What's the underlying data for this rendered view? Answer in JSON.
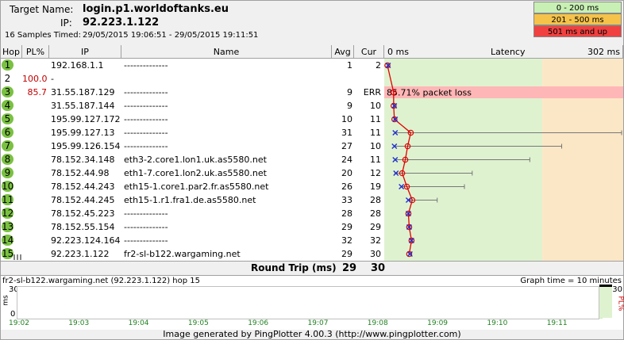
{
  "header": {
    "target_label": "Target Name:",
    "target_value": "login.p1.worldoftanks.eu",
    "ip_label": "IP:",
    "ip_value": "92.223.1.122",
    "samples_label": "16 Samples Timed:",
    "samples_value": "29/05/2015 19:06:51 - 29/05/2015 19:11:51"
  },
  "legend": [
    {
      "label": "0 - 200 ms",
      "color": "#c8f0b4"
    },
    {
      "label": "201 - 500 ms",
      "color": "#f5c24a"
    },
    {
      "label": "501 ms and up",
      "color": "#f04040"
    }
  ],
  "columns": {
    "hop": "Hop",
    "pl": "PL%",
    "ip": "IP",
    "name": "Name",
    "avg": "Avg",
    "cur": "Cur",
    "scale_min": "0 ms",
    "latency": "Latency",
    "scale_max": "302 ms"
  },
  "graph_scale_max": 302,
  "hops": [
    {
      "hop": "1",
      "pl": "",
      "ip": "192.168.1.1",
      "name": "--------------",
      "avg": "1",
      "cur": "2",
      "min": 1,
      "max": 2
    },
    {
      "hop": "2",
      "pl": "100.0",
      "ip": "-",
      "name": "",
      "avg": "",
      "cur": "",
      "min": null,
      "max": null
    },
    {
      "hop": "3",
      "pl": "85.7",
      "ip": "31.55.187.129",
      "name": "--------------",
      "avg": "9",
      "cur": "ERR",
      "min": 9,
      "max": 9,
      "loss_note": "85.71% packet loss"
    },
    {
      "hop": "4",
      "pl": "",
      "ip": "31.55.187.144",
      "name": "--------------",
      "avg": "9",
      "cur": "10",
      "min": 9,
      "max": 10
    },
    {
      "hop": "5",
      "pl": "",
      "ip": "195.99.127.172",
      "name": "--------------",
      "avg": "10",
      "cur": "11",
      "min": 9,
      "max": 11
    },
    {
      "hop": "6",
      "pl": "",
      "ip": "195.99.127.13",
      "name": "--------------",
      "avg": "31",
      "cur": "11",
      "min": 10,
      "max": 302
    },
    {
      "hop": "7",
      "pl": "",
      "ip": "195.99.126.154",
      "name": "--------------",
      "avg": "27",
      "cur": "10",
      "min": 10,
      "max": 225
    },
    {
      "hop": "8",
      "pl": "",
      "ip": "78.152.34.148",
      "name": "eth3-2.core1.lon1.uk.as5580.net",
      "avg": "24",
      "cur": "11",
      "min": 10,
      "max": 184
    },
    {
      "hop": "9",
      "pl": "",
      "ip": "78.152.44.98",
      "name": "eth1-7.core1.lon2.uk.as5580.net",
      "avg": "20",
      "cur": "12",
      "min": 10,
      "max": 110
    },
    {
      "hop": "10",
      "pl": "",
      "ip": "78.152.44.243",
      "name": "eth15-1.core1.par2.fr.as5580.net",
      "avg": "26",
      "cur": "19",
      "min": 18,
      "max": 100
    },
    {
      "hop": "11",
      "pl": "",
      "ip": "78.152.44.245",
      "name": "eth15-1.r1.fra1.de.as5580.net",
      "avg": "33",
      "cur": "28",
      "min": 27,
      "max": 65
    },
    {
      "hop": "12",
      "pl": "",
      "ip": "78.152.45.223",
      "name": "--------------",
      "avg": "28",
      "cur": "28",
      "min": 27,
      "max": 29
    },
    {
      "hop": "13",
      "pl": "",
      "ip": "78.152.55.154",
      "name": "--------------",
      "avg": "29",
      "cur": "29",
      "min": 28,
      "max": 30
    },
    {
      "hop": "14",
      "pl": "",
      "ip": "92.223.124.164",
      "name": "--------------",
      "avg": "32",
      "cur": "32",
      "min": 31,
      "max": 33
    },
    {
      "hop": "15",
      "pl": "",
      "ip": "92.223.1.122",
      "name": "fr2-sl-b122.wargaming.net",
      "avg": "29",
      "cur": "30",
      "min": 28,
      "max": 31
    }
  ],
  "round_trip": {
    "label": "Round Trip (ms)",
    "avg": "29",
    "cur": "30"
  },
  "timeline": {
    "title": "fr2-sl-b122.wargaming.net (92.223.1.122) hop 15",
    "graph_time": "Graph time = 10 minutes",
    "y_top": "30",
    "y_mid": "0",
    "y_axis": "ms",
    "right_axis": "30",
    "right_pl": "PL%",
    "ticks": [
      "19:02",
      "19:03",
      "19:04",
      "19:05",
      "19:06",
      "19:07",
      "19:08",
      "19:09",
      "19:10",
      "19:11"
    ]
  },
  "footer": "Image generated by PingPlotter 4.00.3 (http://www.pingplotter.com)"
}
